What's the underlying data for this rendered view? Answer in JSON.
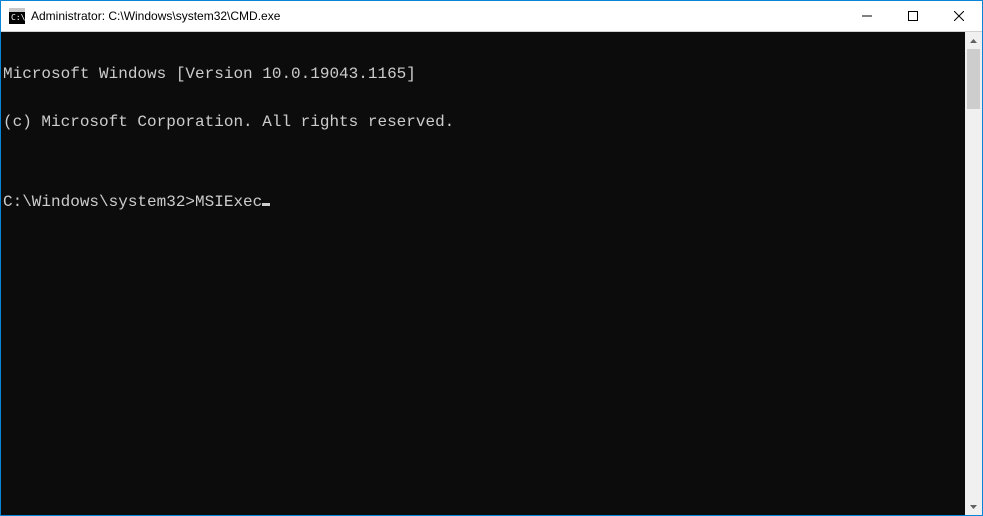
{
  "titlebar": {
    "icon_name": "cmd-icon",
    "title": "Administrator: C:\\Windows\\system32\\CMD.exe",
    "minimize_name": "minimize-icon",
    "maximize_name": "maximize-icon",
    "close_name": "close-icon"
  },
  "console": {
    "lines": [
      "Microsoft Windows [Version 10.0.19043.1165]",
      "(c) Microsoft Corporation. All rights reserved.",
      ""
    ],
    "prompt": "C:\\Windows\\system32>",
    "input": "MSIExec"
  },
  "scrollbar": {
    "up_name": "scroll-up-icon",
    "down_name": "scroll-down-icon"
  }
}
